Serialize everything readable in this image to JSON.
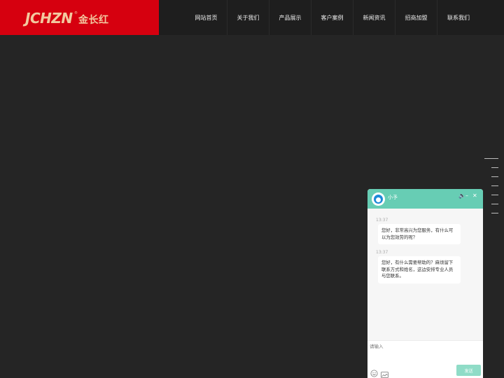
{
  "header": {
    "logo_latin": "JCHZN",
    "logo_mark": "®",
    "logo_cn": "金长红",
    "nav": [
      {
        "label": "网站首页"
      },
      {
        "label": "关于我们"
      },
      {
        "label": "产品展示"
      },
      {
        "label": "客户案例"
      },
      {
        "label": "新闻资讯"
      },
      {
        "label": "招商加盟"
      },
      {
        "label": "联系我们"
      }
    ]
  },
  "chat": {
    "agent_name": "小予",
    "controls": {
      "sound_icon": "speaker-icon",
      "minimize_icon": "minimize-icon",
      "close_icon": "close-icon",
      "sound": "🔈",
      "minimize": "–",
      "close": "✕"
    },
    "messages": [
      {
        "time": "13:37",
        "text": "您好，非常高兴为您服务，有什么可以为您效劳的呢？"
      },
      {
        "time": "13:37",
        "text": "您好，有什么需要帮助的？麻烦留下联系方式和姓名，这边安排专业人员与您联系。"
      }
    ],
    "input_placeholder": "请输入",
    "send_label": "发送",
    "colors": {
      "header": "#67cdb4",
      "send": "#8fdcc7"
    }
  },
  "colors": {
    "logo_bg": "#d6000f",
    "page_bg": "#252525",
    "header_bg": "#1e1e1e"
  }
}
